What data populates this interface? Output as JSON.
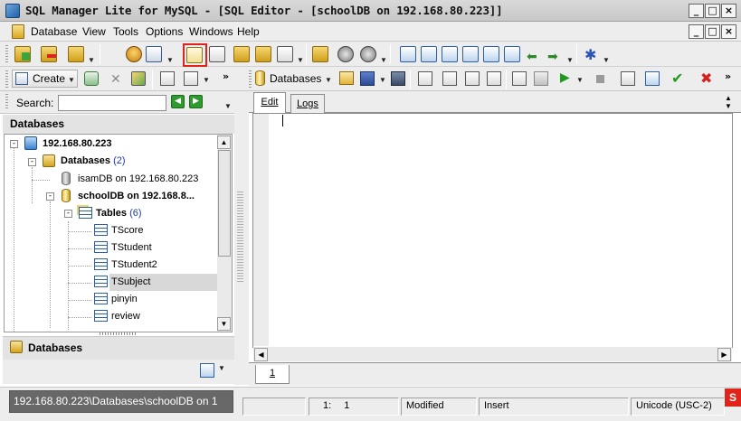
{
  "window": {
    "title": "SQL Manager Lite for MySQL - [SQL Editor - [schoolDB on 192.168.80.223]]",
    "controls": [
      "_",
      "□",
      "×"
    ]
  },
  "menu": {
    "items": [
      "Database",
      "View",
      "Tools",
      "Options",
      "Windows",
      "Help"
    ],
    "mdi_controls": [
      "_",
      "□",
      "×"
    ]
  },
  "toolbar2": {
    "create_label": "Create",
    "databases_label": "Databases"
  },
  "search": {
    "label": "Search:"
  },
  "left_panel": {
    "header": "Databases",
    "footer_label": "Databases",
    "tree": {
      "server": "192.168.80.223",
      "databases_label": "Databases",
      "databases_count": "(2)",
      "db1": "isamDB on 192.168.80.223",
      "db2": "schoolDB on 192.168.8...",
      "tables_label": "Tables",
      "tables_count": "(6)",
      "tables": [
        "TScore",
        "TStudent",
        "TStudent2",
        "TSubject",
        "pinyin",
        "review"
      ],
      "selected_table": "TSubject"
    }
  },
  "editor": {
    "tabs": [
      "Edit",
      "Logs"
    ],
    "active_tab": "Edit",
    "page_tab": "1"
  },
  "status": {
    "path": "192.168.80.223\\Databases\\schoolDB on 1",
    "line": "1:",
    "col": "1",
    "state": "Modified",
    "mode": "Insert",
    "encoding": "Unicode (USC-2)"
  },
  "colors": {
    "highlight": "#e2231a",
    "count_blue": "#1b3aa5",
    "status_path_bg": "#686868"
  },
  "icons": [
    "app-icon",
    "document-icon",
    "add-database-icon",
    "remove-database-icon",
    "sql-editor-icon",
    "run-icon",
    "save-icon",
    "refresh-icon",
    "search-next-icon",
    "check-icon",
    "cancel-icon"
  ]
}
